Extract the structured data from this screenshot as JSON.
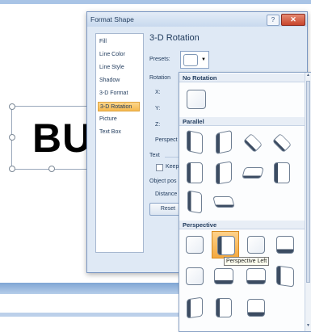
{
  "slide": {
    "big_text": "BU"
  },
  "dialog": {
    "title": "Format Shape",
    "help_label": "?",
    "close_label": "✕",
    "sidebar_items": [
      "Fill",
      "Line Color",
      "Line Style",
      "Shadow",
      "3-D Format",
      "3-D Rotation",
      "Picture",
      "Text Box"
    ],
    "selected_item": "3-D Rotation",
    "section_title": "3-D Rotation",
    "presets_label": "Presets:",
    "rotation_label": "Rotation",
    "x_label": "X:",
    "y_label": "Y:",
    "z_label": "Z:",
    "perspective_label": "Perspect",
    "text_label": "Text",
    "keep_label": "Keep",
    "object_pos_label": "Object pos",
    "distance_label": "Distance",
    "reset_label": "Reset"
  },
  "gallery": {
    "sections": [
      "No Rotation",
      "Parallel",
      "Perspective"
    ],
    "tooltip": "Perspective Left"
  },
  "colors": {
    "accent_orange": "#f4a940",
    "dialog_bg": "#dfe9f5",
    "text": "#1e395b"
  }
}
